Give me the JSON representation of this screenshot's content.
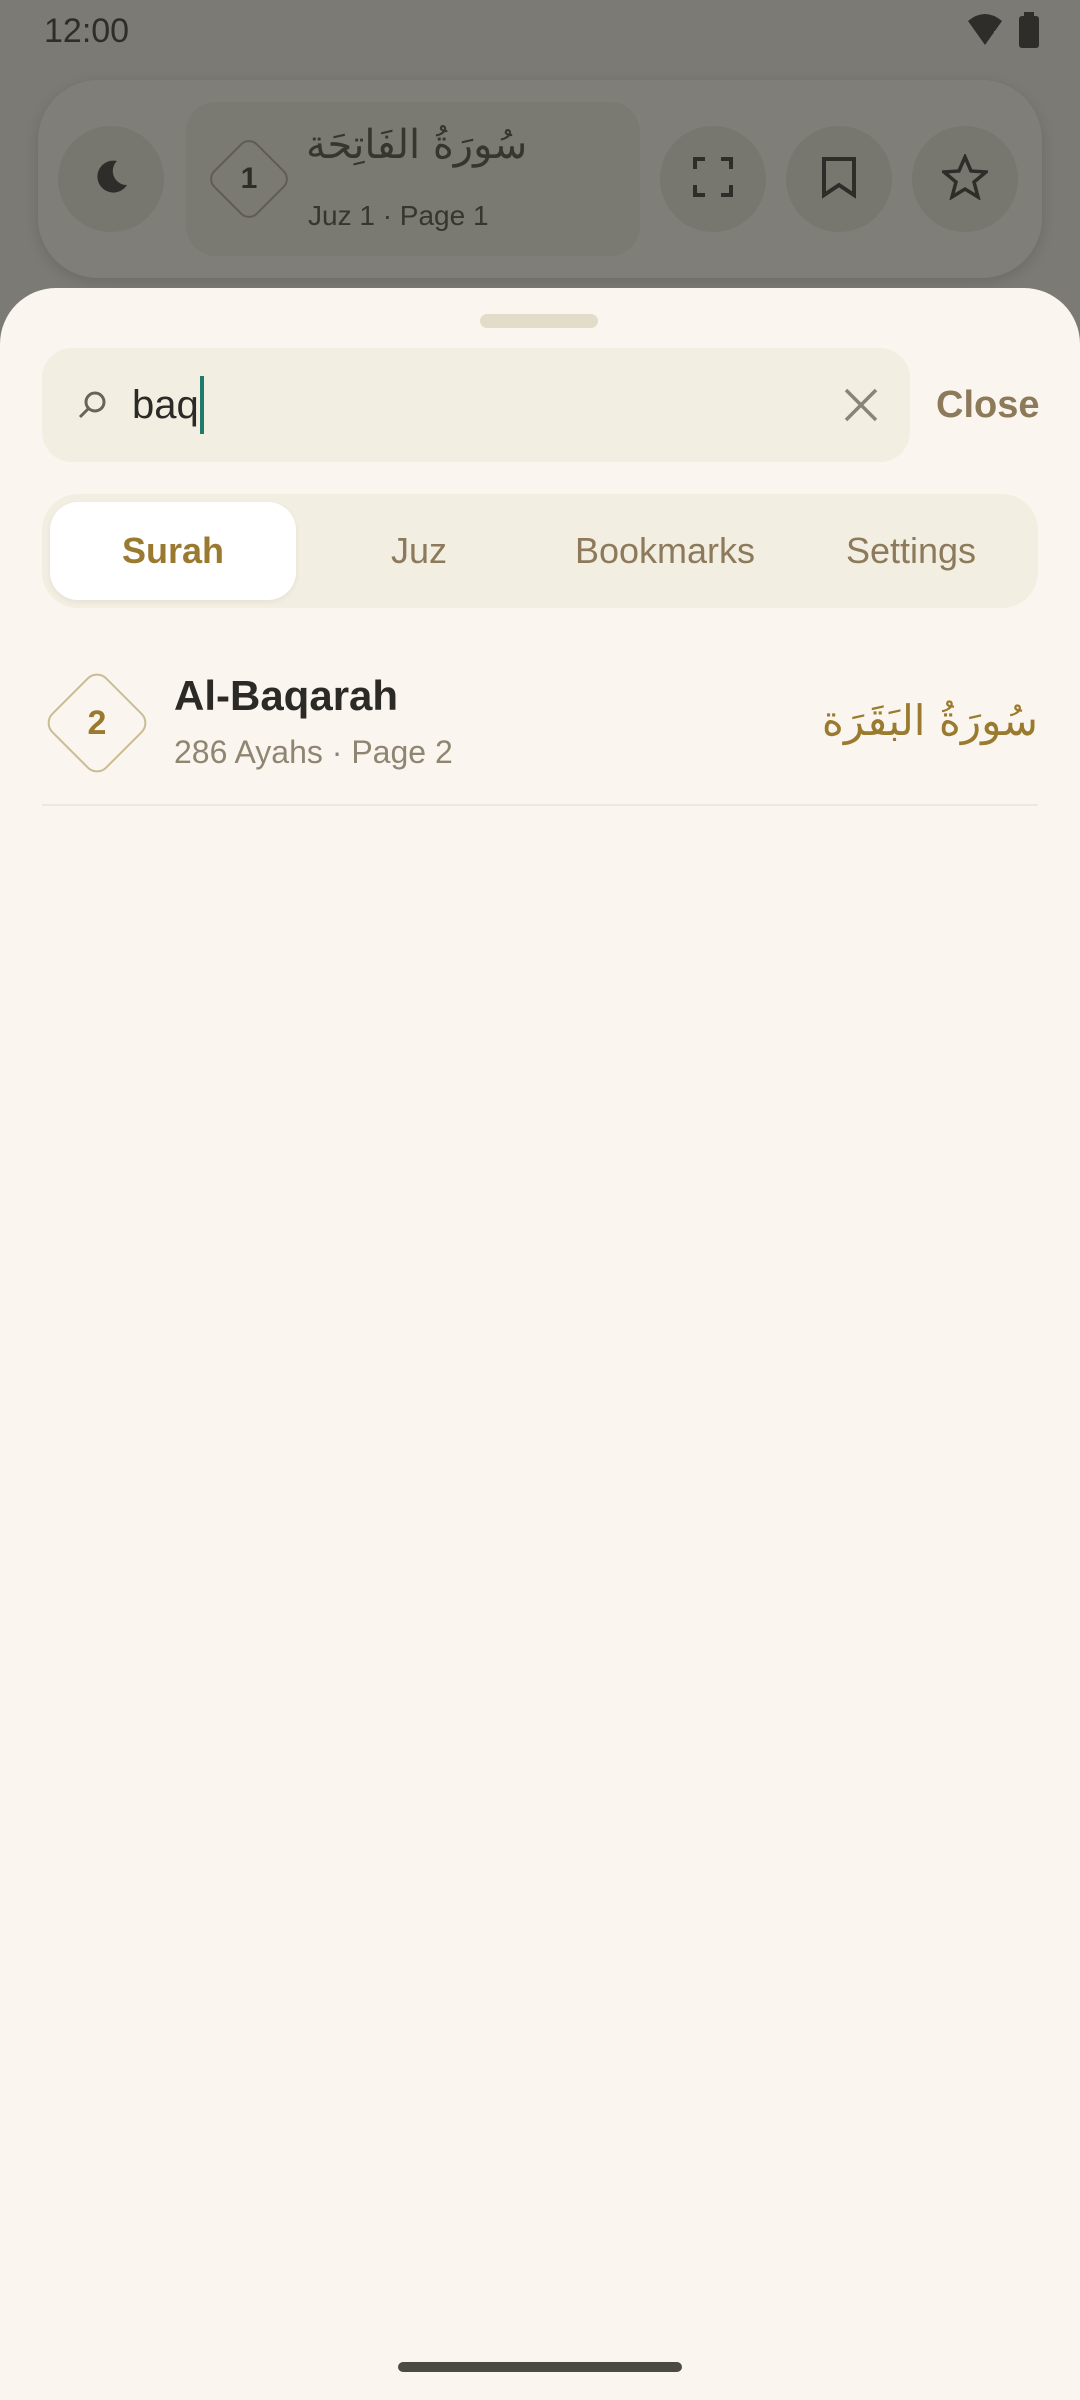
{
  "status_bar": {
    "time": "12:00",
    "icons": [
      "wifi-icon",
      "battery-icon"
    ]
  },
  "top_bar": {
    "dark_mode_icon": "moon-icon",
    "surah_number": "1",
    "surah_arabic": "سُورَةُ الفَاتِحَة",
    "subtitle": "Juz 1 · Page 1",
    "fullscreen_icon": "fullscreen-icon",
    "bookmark_icon": "bookmark-icon",
    "star_icon": "star-icon"
  },
  "search": {
    "value": "baq",
    "placeholder": "",
    "close_label": "Close"
  },
  "tabs": [
    {
      "label": "Surah",
      "active": true
    },
    {
      "label": "Juz",
      "active": false
    },
    {
      "label": "Bookmarks",
      "active": false
    },
    {
      "label": "Settings",
      "active": false
    }
  ],
  "results": [
    {
      "number": "2",
      "name": "Al-Baqarah",
      "details": "286 Ayahs · Page 2",
      "arabic": "سُورَةُ البَقَرَة"
    }
  ],
  "colors": {
    "accent": "#9a7a2f",
    "caret": "#1f7a6c",
    "sheet_bg": "#faf6ef"
  }
}
